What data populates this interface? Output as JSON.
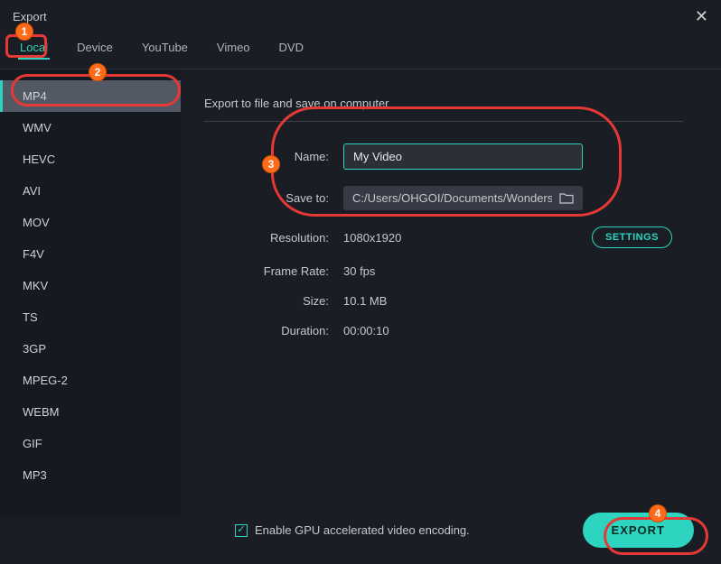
{
  "window": {
    "title": "Export"
  },
  "tabs": [
    "Local",
    "Device",
    "YouTube",
    "Vimeo",
    "DVD"
  ],
  "active_tab": 0,
  "formats": [
    "MP4",
    "WMV",
    "HEVC",
    "AVI",
    "MOV",
    "F4V",
    "MKV",
    "TS",
    "3GP",
    "MPEG-2",
    "WEBM",
    "GIF",
    "MP3"
  ],
  "selected_format": 0,
  "section_header": "Export to file and save on computer",
  "form": {
    "name_label": "Name:",
    "name_value": "My Video",
    "saveto_label": "Save to:",
    "saveto_value": "C:/Users/OHGOI/Documents/Wondershare",
    "resolution_label": "Resolution:",
    "resolution_value": "1080x1920",
    "framerate_label": "Frame Rate:",
    "framerate_value": "30 fps",
    "size_label": "Size:",
    "size_value": "10.1 MB",
    "duration_label": "Duration:",
    "duration_value": "00:00:10",
    "settings_btn": "SETTINGS"
  },
  "gpu_checkbox": {
    "checked": true,
    "label": "Enable GPU accelerated video encoding."
  },
  "export_btn": "EXPORT",
  "annotations": {
    "b1": "1",
    "b2": "2",
    "b3": "3",
    "b4": "4"
  }
}
